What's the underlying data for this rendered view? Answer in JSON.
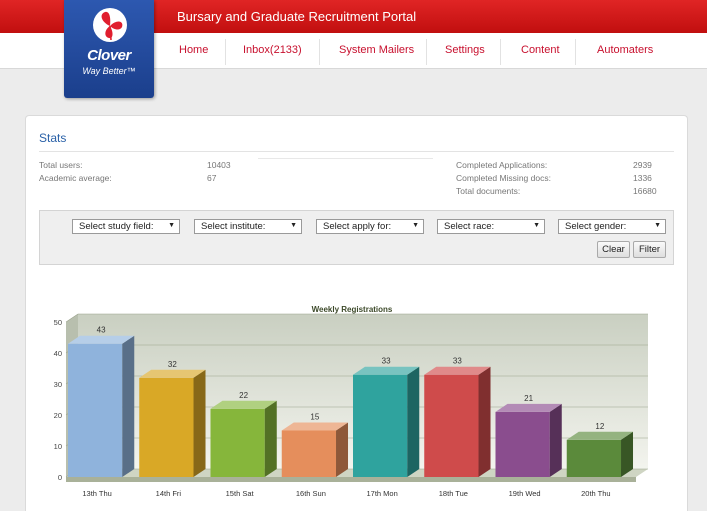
{
  "header": {
    "portal_title": "Bursary and Graduate Recruitment Portal",
    "logo_text": "Clover",
    "logo_tagline": "Way Better™"
  },
  "nav": [
    {
      "label": "Home"
    },
    {
      "label": "Inbox(2133)"
    },
    {
      "label": "System Mailers"
    },
    {
      "label": "Settings"
    },
    {
      "label": "Content"
    },
    {
      "label": "Automaters"
    }
  ],
  "stats": {
    "title": "Stats",
    "left": [
      {
        "label": "Total users:",
        "value": "10403"
      },
      {
        "label": "Academic average:",
        "value": "67"
      }
    ],
    "right": [
      {
        "label": "Completed Applications:",
        "value": "2939"
      },
      {
        "label": "Completed Missing docs:",
        "value": "1336"
      },
      {
        "label": "Total documents:",
        "value": "16680"
      }
    ]
  },
  "filters": {
    "selects": [
      {
        "value": "Select study field:"
      },
      {
        "value": "Select institute:"
      },
      {
        "value": "Select apply for:"
      },
      {
        "value": "Select race:"
      },
      {
        "value": "Select gender:"
      }
    ],
    "clear_label": "Clear",
    "filter_label": "Filter"
  },
  "colors": {
    "brand_red": "#c8102e",
    "brand_blue": "#1f4597"
  },
  "chart_data": {
    "type": "bar",
    "title": "Weekly Registrations",
    "categories": [
      "13th Thu",
      "14th Fri",
      "15th Sat",
      "16th Sun",
      "17th Mon",
      "18th Tue",
      "19th Wed",
      "20th Thu"
    ],
    "values": [
      43,
      32,
      22,
      15,
      33,
      33,
      21,
      12
    ],
    "colors": [
      "#8fb3dc",
      "#d9a826",
      "#86b63b",
      "#e58e5c",
      "#2fa39e",
      "#cf4b4b",
      "#8a4d8e",
      "#5b8a3b"
    ],
    "ylim": [
      0,
      50
    ],
    "yticks": [
      0,
      10,
      20,
      30,
      40,
      50
    ],
    "grid": true,
    "style": "3d"
  }
}
